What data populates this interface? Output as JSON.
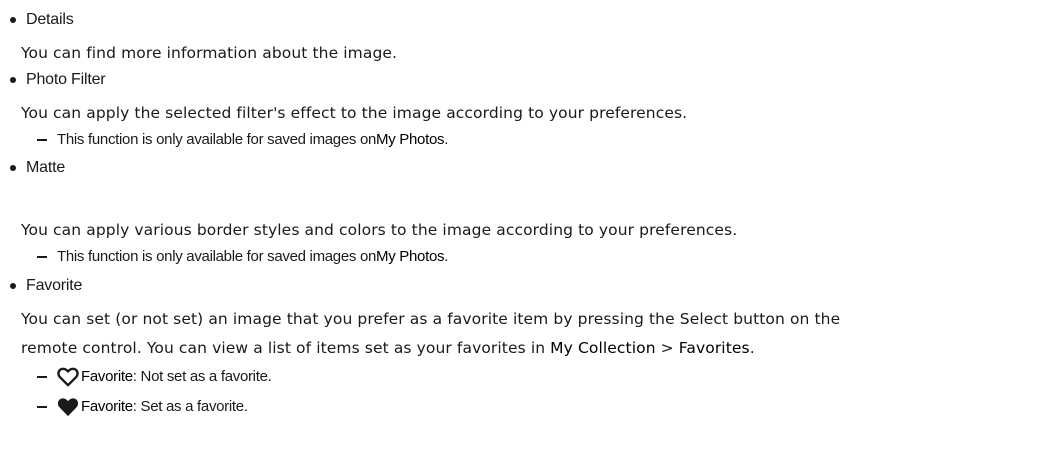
{
  "items": [
    {
      "title": "Details",
      "desc": "You can find more information about the image."
    },
    {
      "title": "Photo Filter",
      "desc": "You can apply the selected filter's effect to the image according to your preferences.",
      "note_prefix": "This function is only available for saved images on ",
      "note_link": "My Photos",
      "note_suffix": "."
    },
    {
      "title": "Matte",
      "desc": "You can apply various border styles and colors to the image according to your preferences.",
      "note_prefix": "This function is only available for saved images on ",
      "note_link": "My Photos",
      "note_suffix": "."
    },
    {
      "title": "Favorite",
      "desc_line1": "You can set (or not set) an image that you prefer as a favorite item by pressing the Select button on the",
      "desc_line2_prefix": "remote control. You can view a list of items set as your favorites in ",
      "desc_line2_path1": "My Collection",
      "desc_line2_sep": " > ",
      "desc_line2_path2": "Favorites",
      "desc_line2_suffix": ".",
      "states": [
        {
          "icon": "heart-outline-icon",
          "label": "Favorite",
          "text": ": Not set as a favorite."
        },
        {
          "icon": "heart-filled-icon",
          "label": "Favorite",
          "text": ": Set as a favorite."
        }
      ]
    }
  ]
}
